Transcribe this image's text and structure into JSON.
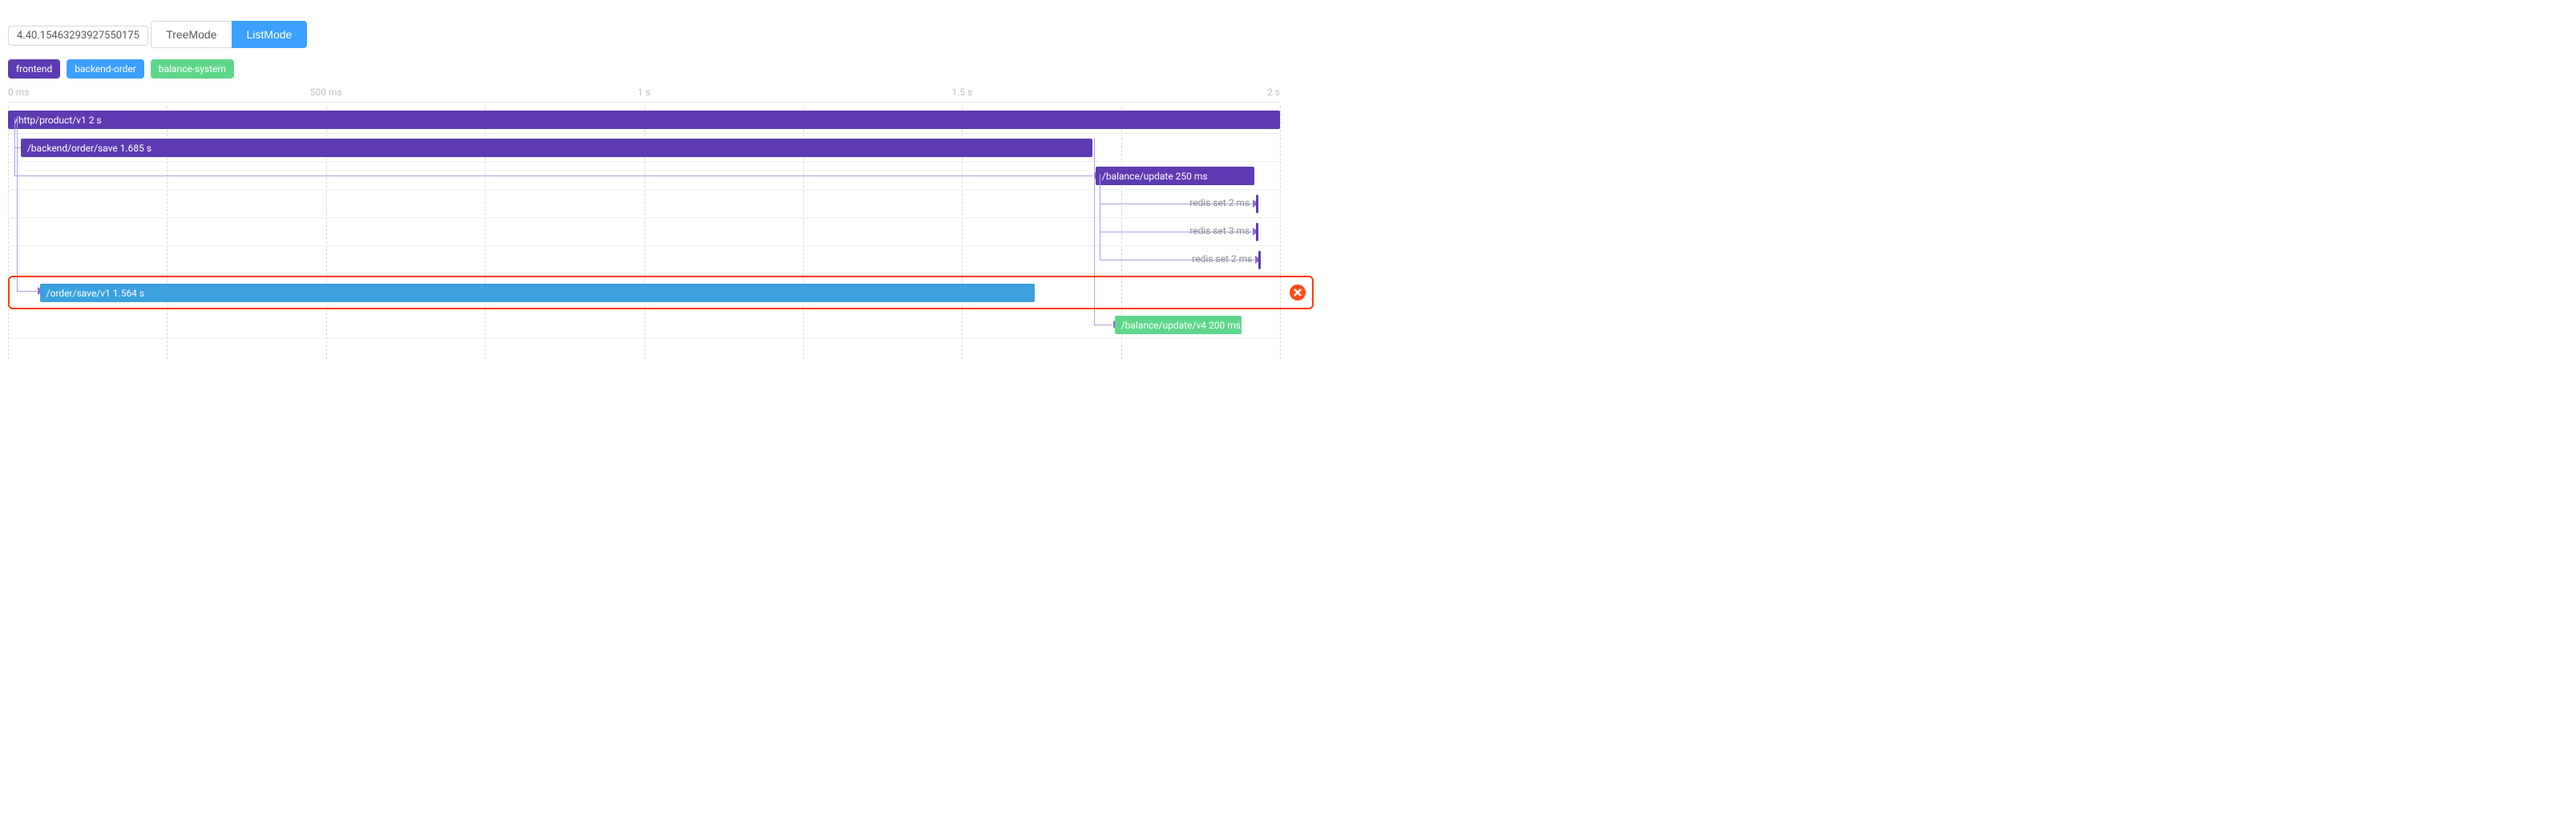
{
  "trace_id": "4.40.15463293927550175",
  "modes": {
    "tree": "TreeMode",
    "list": "ListMode",
    "active": "list"
  },
  "services": [
    {
      "name": "frontend",
      "color": "purple"
    },
    {
      "name": "backend-order",
      "color": "blue"
    },
    {
      "name": "balance-system",
      "color": "green"
    }
  ],
  "axis": {
    "ticks": [
      {
        "pct": 0,
        "label": "0 ms",
        "edge": "first"
      },
      {
        "pct": 25,
        "label": "500 ms"
      },
      {
        "pct": 50,
        "label": "1 s"
      },
      {
        "pct": 75,
        "label": "1.5 s"
      },
      {
        "pct": 100,
        "label": "2 s",
        "edge": "last"
      }
    ],
    "total_ms": 2000
  },
  "spans": [
    {
      "id": "http-product",
      "label": "/http/product/v1 2 s",
      "path": "/http/product/v1",
      "duration": "2 s",
      "start_pct": 0,
      "width_pct": 100,
      "color": "purple",
      "row": 0,
      "parent": null,
      "label_inside": true
    },
    {
      "id": "backend-save",
      "label": "/backend/order/save 1.685 s",
      "path": "/backend/order/save",
      "duration": "1.685 s",
      "start_pct": 1,
      "width_pct": 84.25,
      "color": "purple",
      "row": 1,
      "parent": "http-product",
      "label_inside": true
    },
    {
      "id": "balance-update",
      "label": "/balance/update 250 ms",
      "path": "/balance/update",
      "duration": "250 ms",
      "start_pct": 85.5,
      "width_pct": 12.5,
      "color": "purple",
      "row": 2,
      "parent": "backend-save",
      "label_inside": true
    },
    {
      "id": "redis1",
      "label": "redis set 2 ms",
      "op": "redis set",
      "duration": "2 ms",
      "start_pct": 98.1,
      "width_pct": 0.2,
      "color": "purple",
      "row": 3,
      "parent": "balance-update",
      "label_inside": false
    },
    {
      "id": "redis2",
      "label": "redis set 3 ms",
      "op": "redis set",
      "duration": "3 ms",
      "start_pct": 98.1,
      "width_pct": 0.2,
      "color": "purple",
      "row": 4,
      "parent": "balance-update",
      "label_inside": false
    },
    {
      "id": "redis3",
      "label": "redis set 2 ms",
      "op": "redis set",
      "duration": "2 ms",
      "start_pct": 98.3,
      "width_pct": 0.2,
      "color": "purple",
      "row": 5,
      "parent": "balance-update",
      "label_inside": false
    },
    {
      "id": "order-save",
      "label": "/order/save/v1 1.564 s",
      "path": "/order/save/v1",
      "duration": "1.564 s",
      "start_pct": 2.5,
      "width_pct": 78.2,
      "color": "blue",
      "row": 6,
      "parent": "http-product",
      "label_inside": true,
      "error": true
    },
    {
      "id": "balance-v4",
      "label": "/balance/update/v4 200 ms",
      "path": "/balance/update/v4",
      "duration": "200 ms",
      "start_pct": 87,
      "width_pct": 10,
      "color": "green",
      "row": 7,
      "parent": "backend-save",
      "label_inside": true
    }
  ]
}
